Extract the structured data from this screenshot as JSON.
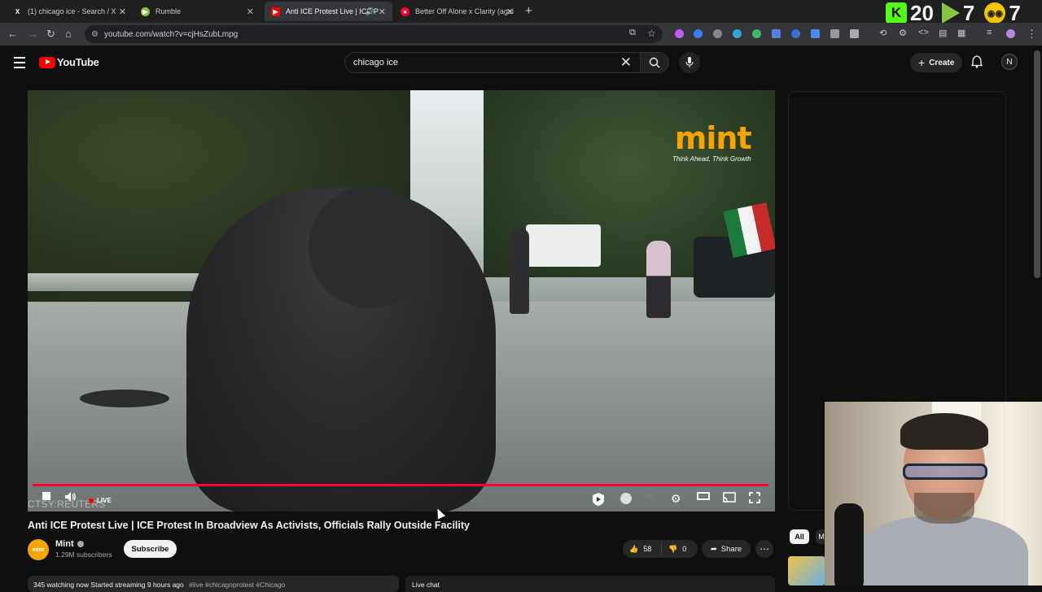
{
  "browser": {
    "tabs": [
      {
        "title": "(1) chicago ice - Search / X",
        "favicon": "x-icon",
        "active": false
      },
      {
        "title": "Rumble",
        "favicon": "rumble-icon",
        "active": false
      },
      {
        "title": "Anti ICE Protest Live | ICE P",
        "favicon": "youtube-icon",
        "active": true
      },
      {
        "title": "Better Off Alone x Clarity (agai",
        "favicon": "youtube-music-icon",
        "active": false
      }
    ],
    "url": "youtube.com/watch?v=cjHsZubLmpg"
  },
  "overlay": {
    "kick_count": "20",
    "rumble_count": "7",
    "third_count": "7",
    "kick_badge": "K"
  },
  "youtube": {
    "logo_text": "YouTube",
    "search_query": "chicago ice",
    "create_label": "Create",
    "avatar_letter": "N"
  },
  "video": {
    "brand": "mint",
    "brand_tagline": "Think Ahead, Think Growth",
    "credit": "CTSY:REUTERS",
    "live_label": "LIVE",
    "title": "Anti ICE Protest Live | ICE Protest In Broadview As Activists, Officials Rally Outside Facility",
    "channel": "Mint",
    "channel_avatar": "mint",
    "subscribers": "1.29M subscribers",
    "subscribe_label": "Subscribe",
    "likes": "58",
    "dislikes": "0",
    "share_label": "Share",
    "description": "345 watching now  Started streaming 9 hours ago",
    "description_tags": "#live #chicagoprotest #Chicago",
    "live_chat_label": "Live chat"
  },
  "sidebar": {
    "chips": [
      "All",
      "M"
    ]
  }
}
